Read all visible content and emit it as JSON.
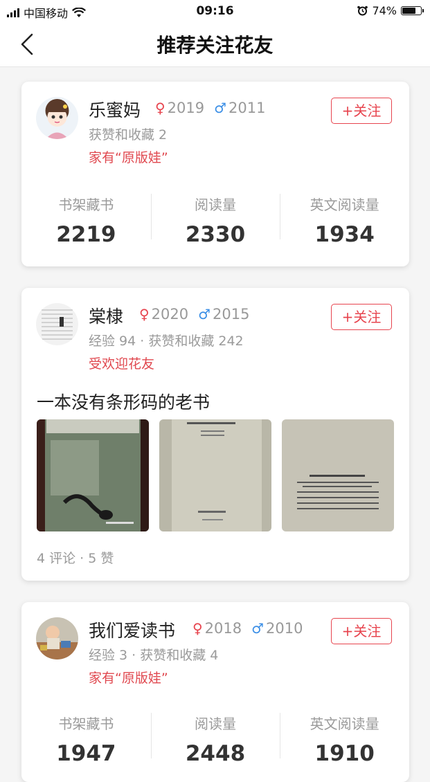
{
  "status_bar": {
    "carrier": "中国移动",
    "time": "09:16",
    "battery_text": "74%",
    "battery_level": 0.74,
    "icons": [
      "signal-icon",
      "wifi-icon",
      "alarm-icon",
      "battery-icon"
    ]
  },
  "nav": {
    "title": "推荐关注花友",
    "back_icon": "chevron-left-icon"
  },
  "colors": {
    "accent_red": "#e7444e",
    "male_blue": "#3a8ee6",
    "muted_gray": "#9a9a9a"
  },
  "cards": [
    {
      "name": "乐蜜妈",
      "female_year": "2019",
      "male_year": "2011",
      "meta": "获赞和收藏 2",
      "badge": "家有“原版娃”",
      "follow": "+关注",
      "stats": [
        {
          "label": "书架藏书",
          "value": "2219"
        },
        {
          "label": "阅读量",
          "value": "2330"
        },
        {
          "label": "英文阅读量",
          "value": "1934"
        }
      ]
    },
    {
      "name": "棠棣",
      "female_year": "2020",
      "male_year": "2015",
      "meta": "经验 94 · 获赞和收藏 242",
      "badge": "受欢迎花友",
      "follow": "+关注",
      "post_title": "一本没有条形码的老书",
      "post_stats": "4 评论 · 5 赞"
    },
    {
      "name": "我们爱读书",
      "female_year": "2018",
      "male_year": "2010",
      "meta": "经验 3 · 获赞和收藏 4",
      "badge": "家有“原版娃”",
      "follow": "+关注",
      "stats": [
        {
          "label": "书架藏书",
          "value": "1947"
        },
        {
          "label": "阅读量",
          "value": "2448"
        },
        {
          "label": "英文阅读量",
          "value": "1910"
        }
      ]
    }
  ]
}
